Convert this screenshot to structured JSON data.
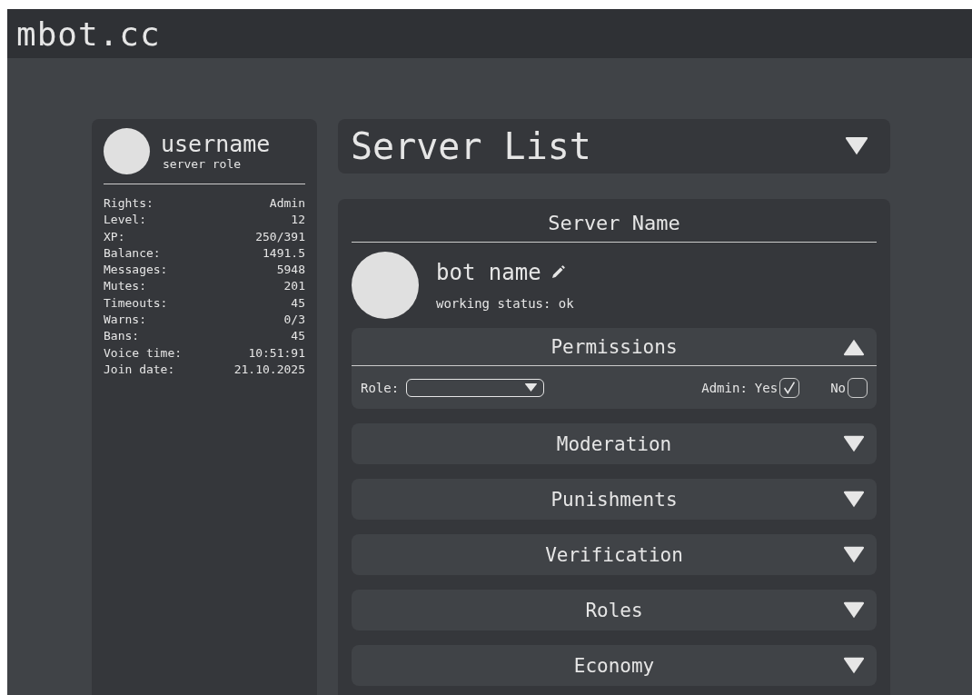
{
  "site": {
    "title": "mbot.cc"
  },
  "profile": {
    "username": "username",
    "role": "server role",
    "stats": [
      {
        "label": "Rights:",
        "value": "Admin"
      },
      {
        "label": "Level:",
        "value": "12"
      },
      {
        "label": "XP:",
        "value": "250/391"
      },
      {
        "label": "Balance:",
        "value": "1491.5"
      },
      {
        "label": "Messages:",
        "value": "5948"
      },
      {
        "label": "Mutes:",
        "value": "201"
      },
      {
        "label": "Timeouts:",
        "value": "45"
      },
      {
        "label": "Warns:",
        "value": "0/3"
      },
      {
        "label": "Bans:",
        "value": "45"
      },
      {
        "label": "Voice time:",
        "value": "10:51:91"
      },
      {
        "label": "Join date:",
        "value": "21.10.2025"
      }
    ]
  },
  "server_list": {
    "title": "Server List",
    "expanded": false
  },
  "server": {
    "name": "Server Name",
    "bot_name": "bot name",
    "status": "working status: ok",
    "sections": [
      {
        "title": "Permissions",
        "expanded": true,
        "role_label": "Role:",
        "admin_label": "Admin:",
        "options": [
          {
            "label": "Yes",
            "checked": true
          },
          {
            "label": "No",
            "checked": false
          }
        ]
      },
      {
        "title": "Moderation",
        "expanded": false
      },
      {
        "title": "Punishments",
        "expanded": false
      },
      {
        "title": "Verification",
        "expanded": false
      },
      {
        "title": "Roles",
        "expanded": false
      },
      {
        "title": "Economy",
        "expanded": false
      }
    ]
  }
}
